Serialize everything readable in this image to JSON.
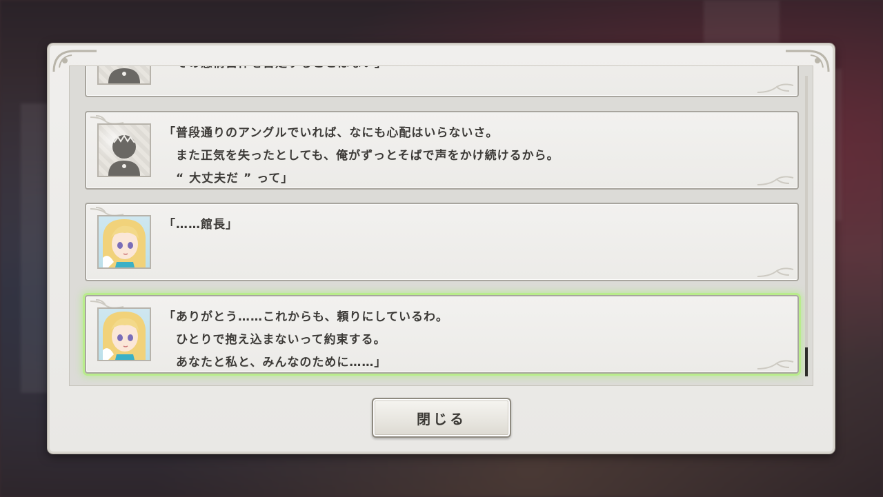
{
  "backlog": {
    "entries": [
      {
        "speaker": "protagonist",
        "avatar_icon": "silhouette-avatar-icon",
        "lines": [
          "",
          "　その感情自体を否定することはない」"
        ]
      },
      {
        "speaker": "protagonist",
        "avatar_icon": "silhouette-avatar-icon",
        "lines": [
          "「普段通りのアングルでいれば、なにも心配はいらないさ。",
          "　また正気を失ったとしても、俺がずっとそばで声をかけ続けるから。",
          "　“ 大丈夫だ ” って」"
        ]
      },
      {
        "speaker": "heroine",
        "avatar_icon": "blonde-girl-avatar-icon",
        "lines": [
          "「……館長」"
        ]
      },
      {
        "speaker": "heroine",
        "avatar_icon": "blonde-girl-avatar-icon",
        "lines": [
          "「ありがとう……これからも、頼りにしているわ。",
          "　ひとりで抱え込まないって約束する。",
          "　あなたと私と、みんなのために……」"
        ],
        "active": true
      }
    ]
  },
  "close_button": {
    "label": "閉じる"
  },
  "colors": {
    "panel": "#eeedea",
    "border": "#a8a59e",
    "highlight": "#b9ec8c",
    "text": "#3c3a37"
  }
}
